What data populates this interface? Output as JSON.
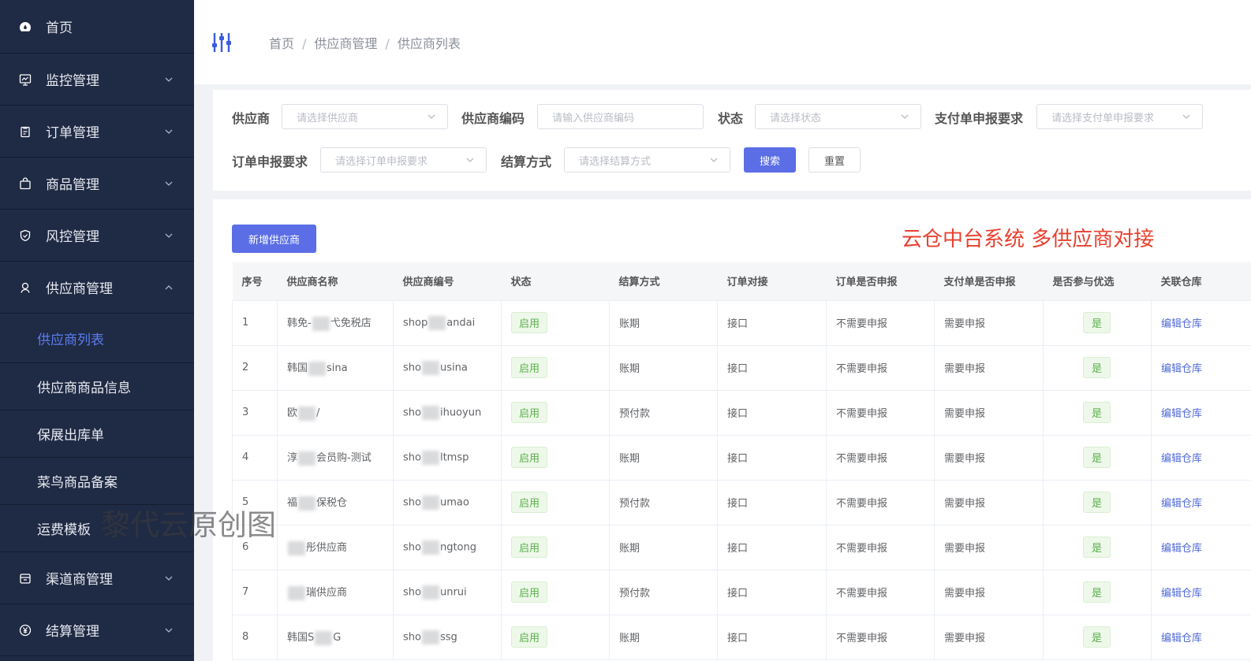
{
  "sidebar": {
    "items": [
      {
        "label": "首页",
        "icon": "dashboard-icon"
      },
      {
        "label": "监控管理",
        "icon": "monitor-icon"
      },
      {
        "label": "订单管理",
        "icon": "clipboard-icon"
      },
      {
        "label": "商品管理",
        "icon": "bag-icon"
      },
      {
        "label": "风控管理",
        "icon": "shield-icon"
      },
      {
        "label": "供应商管理",
        "icon": "supplier-icon"
      },
      {
        "label": "渠道商管理",
        "icon": "channel-icon"
      },
      {
        "label": "结算管理",
        "icon": "yuan-icon"
      }
    ],
    "sub_items": [
      "供应商列表",
      "供应商商品信息",
      "保展出库单",
      "菜鸟商品备案",
      "运费模板"
    ]
  },
  "breadcrumb": [
    "首页",
    "供应商管理",
    "供应商列表"
  ],
  "search": {
    "supplier_label": "供应商",
    "supplier_placeholder": "请选择供应商",
    "code_label": "供应商编码",
    "code_placeholder": "请输入供应商编码",
    "status_label": "状态",
    "status_placeholder": "请选择状态",
    "pay_label": "支付单申报要求",
    "pay_placeholder": "请选择支付单申报要求",
    "order_label": "订单申报要求",
    "order_placeholder": "请选择订单申报要求",
    "settle_label": "结算方式",
    "settle_placeholder": "请选择结算方式",
    "search_button": "搜索",
    "reset_button": "重置"
  },
  "toolbar": {
    "add_button": "新增供应商",
    "promo_text": "云仓中台系统 多供应商对接"
  },
  "table": {
    "headers": [
      "序号",
      "供应商名称",
      "供应商编号",
      "状态",
      "结算方式",
      "订单对接",
      "订单是否申报",
      "支付单是否申报",
      "是否参与优选",
      "关联仓库"
    ],
    "rows": [
      {
        "no": "1",
        "name_a": "韩免-",
        "name_b": "弋免税店",
        "code_a": "shop",
        "code_b": "andai",
        "status": "启用",
        "settle": "账期",
        "dock": "接口",
        "order_decl": "不需要申报",
        "pay_decl": "需要申报",
        "preferred": "是",
        "action": "编辑仓库"
      },
      {
        "no": "2",
        "name_a": "韩国",
        "name_b": "sina",
        "code_a": "sho",
        "code_b": "usina",
        "status": "启用",
        "settle": "账期",
        "dock": "接口",
        "order_decl": "不需要申报",
        "pay_decl": "需要申报",
        "preferred": "是",
        "action": "编辑仓库"
      },
      {
        "no": "3",
        "name_a": "欧",
        "name_b": "/",
        "code_a": "sho",
        "code_b": "ihuoyun",
        "status": "启用",
        "settle": "预付款",
        "dock": "接口",
        "order_decl": "不需要申报",
        "pay_decl": "需要申报",
        "preferred": "是",
        "action": "编辑仓库"
      },
      {
        "no": "4",
        "name_a": "淳",
        "name_b": "会员购-测试",
        "code_a": "sho",
        "code_b": "ltmsp",
        "status": "启用",
        "settle": "账期",
        "dock": "接口",
        "order_decl": "不需要申报",
        "pay_decl": "需要申报",
        "preferred": "是",
        "action": "编辑仓库"
      },
      {
        "no": "5",
        "name_a": "福",
        "name_b": "保税仓",
        "code_a": "sho",
        "code_b": "umao",
        "status": "启用",
        "settle": "预付款",
        "dock": "接口",
        "order_decl": "不需要申报",
        "pay_decl": "需要申报",
        "preferred": "是",
        "action": "编辑仓库"
      },
      {
        "no": "6",
        "name_a": "",
        "name_b": "彤供应商",
        "code_a": "sho",
        "code_b": "ngtong",
        "status": "启用",
        "settle": "账期",
        "dock": "接口",
        "order_decl": "不需要申报",
        "pay_decl": "需要申报",
        "preferred": "是",
        "action": "编辑仓库"
      },
      {
        "no": "7",
        "name_a": "",
        "name_b": "瑞供应商",
        "code_a": "sho",
        "code_b": "unrui",
        "status": "启用",
        "settle": "预付款",
        "dock": "接口",
        "order_decl": "不需要申报",
        "pay_decl": "需要申报",
        "preferred": "是",
        "action": "编辑仓库"
      },
      {
        "no": "8",
        "name_a": "韩国S",
        "name_b": "G",
        "code_a": "sho",
        "code_b": "ssg",
        "status": "启用",
        "settle": "账期",
        "dock": "接口",
        "order_decl": "不需要申报",
        "pay_decl": "需要申报",
        "preferred": "是",
        "action": "编辑仓库"
      }
    ]
  },
  "watermark": "黎代云原创图",
  "colors": {
    "sidebar_bg": "#1f2a44",
    "primary": "#5b6ee6",
    "active": "#5b7cf0",
    "tag_green": "#5ab04b",
    "promo_red": "#e8402f"
  }
}
